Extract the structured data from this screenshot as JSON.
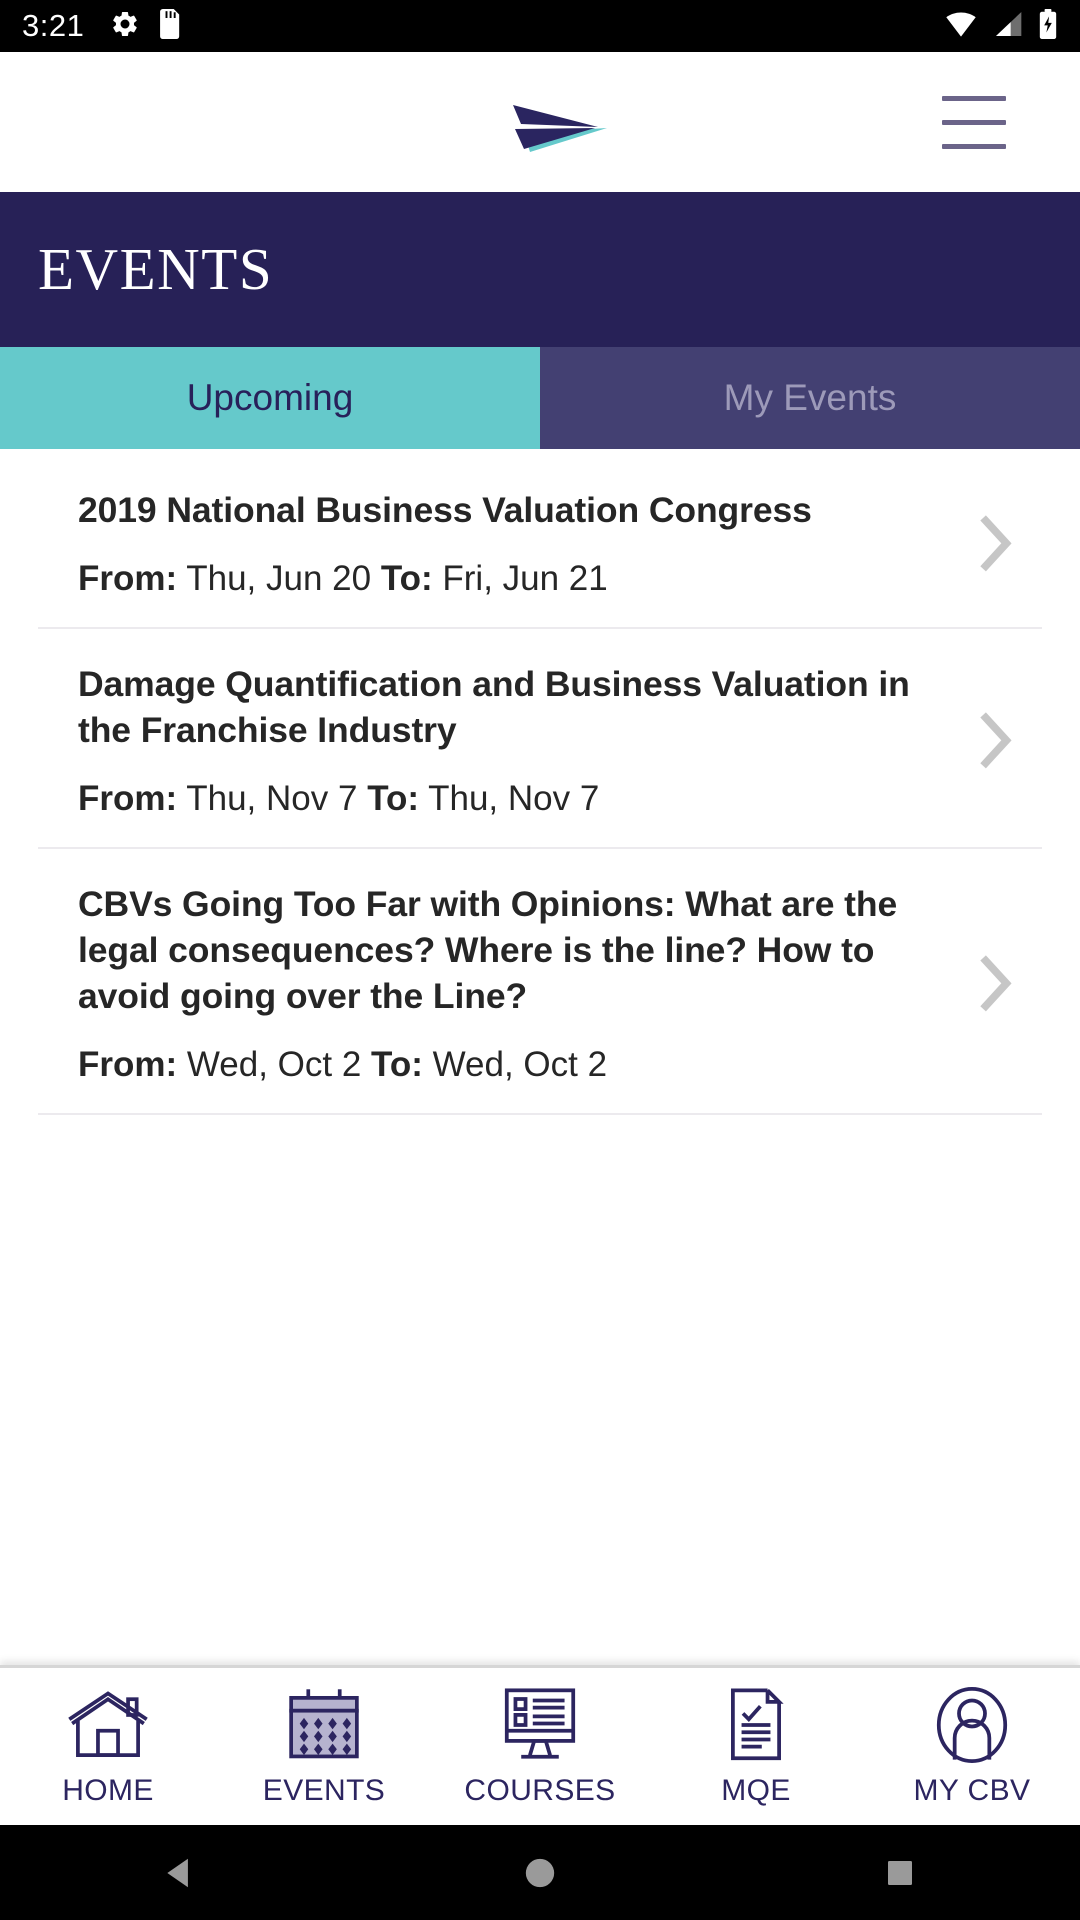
{
  "status_bar": {
    "time": "3:21",
    "left_icons": [
      "settings-gear-icon",
      "sd-card-icon"
    ],
    "right_icons": [
      "wifi-icon",
      "cell-signal-icon",
      "battery-charging-icon"
    ]
  },
  "top_bar": {
    "logo_name": "cbv-paper-plane-logo",
    "logo_colors": {
      "dark": "#2a2560",
      "teal": "#65c9cb"
    },
    "menu_label": "Menu"
  },
  "header": {
    "title": "EVENTS",
    "background": "#272157"
  },
  "tabs": [
    {
      "label": "Upcoming",
      "active": true
    },
    {
      "label": "My Events",
      "active": false
    }
  ],
  "events": [
    {
      "title": "2019 National Business Valuation Congress",
      "from_label": "From:",
      "from_value": "Thu, Jun 20",
      "to_label": "To:",
      "to_value": "Fri, Jun 21"
    },
    {
      "title": "Damage Quantification and Business Valuation in the Franchise Industry",
      "from_label": "From:",
      "from_value": "Thu, Nov 7",
      "to_label": "To:",
      "to_value": "Thu, Nov 7"
    },
    {
      "title": "CBVs Going Too Far with Opinions: What are the legal consequences? Where is the line? How to avoid going over the Line?",
      "from_label": "From:",
      "from_value": "Wed, Oct 2",
      "to_label": "To:",
      "to_value": "Wed, Oct 2"
    }
  ],
  "bottom_nav": [
    {
      "label": "HOME",
      "icon": "house-icon"
    },
    {
      "label": "EVENTS",
      "icon": "calendar-icon"
    },
    {
      "label": "COURSES",
      "icon": "monitor-list-icon"
    },
    {
      "label": "MQE",
      "icon": "document-check-icon"
    },
    {
      "label": "MY CBV",
      "icon": "person-circle-icon"
    }
  ],
  "android_nav": {
    "back": "back-triangle-icon",
    "home": "home-circle-icon",
    "recents": "recents-square-icon"
  },
  "colors": {
    "navy": "#272157",
    "teal": "#65c9cb",
    "tab_inactive": "#434072",
    "chevron": "#c6c6c6"
  }
}
